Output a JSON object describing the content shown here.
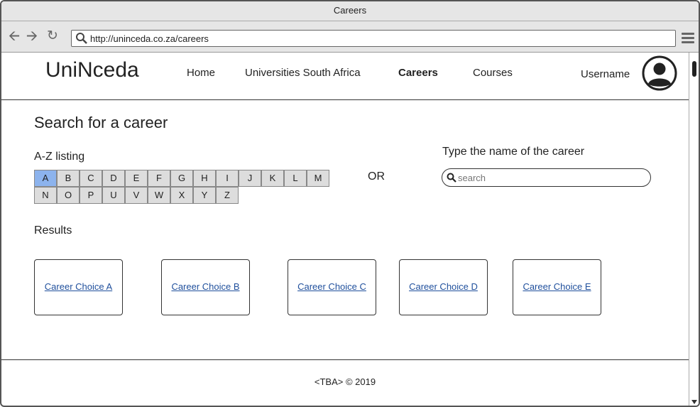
{
  "window": {
    "title": "Careers"
  },
  "browser": {
    "url": "http://uninceda.co.za/careers",
    "back_icon": "arrow-left-icon",
    "forward_icon": "arrow-right-icon",
    "reload_icon": "reload-icon",
    "menu_icon": "hamburger-menu-icon"
  },
  "header": {
    "logo": "UniNceda",
    "nav": [
      {
        "label": "Home",
        "active": false
      },
      {
        "label": "Universities South Africa",
        "active": false
      },
      {
        "label": "Careers",
        "active": true
      },
      {
        "label": "Courses",
        "active": false
      }
    ],
    "username": "Username"
  },
  "main": {
    "title": "Search for a career",
    "az_label": "A-Z listing",
    "letters": [
      "A",
      "B",
      "C",
      "D",
      "E",
      "F",
      "G",
      "H",
      "I",
      "J",
      "K",
      "L",
      "M",
      "N",
      "O",
      "P",
      "U",
      "V",
      "W",
      "X",
      "Y",
      "Z"
    ],
    "selected_letter": "A",
    "or_label": "OR",
    "search_label": "Type the name of the career",
    "search_placeholder": "search",
    "results_label": "Results",
    "results": [
      "Career Choice A",
      "Career Choice B",
      "Career Choice C",
      "Career Choice D",
      "Career Choice E"
    ]
  },
  "footer": {
    "text": "<TBA> © 2019"
  },
  "colors": {
    "selected_letter": "#8cb3ed",
    "link": "#1f4f9c",
    "chrome": "#e6e6e6"
  }
}
